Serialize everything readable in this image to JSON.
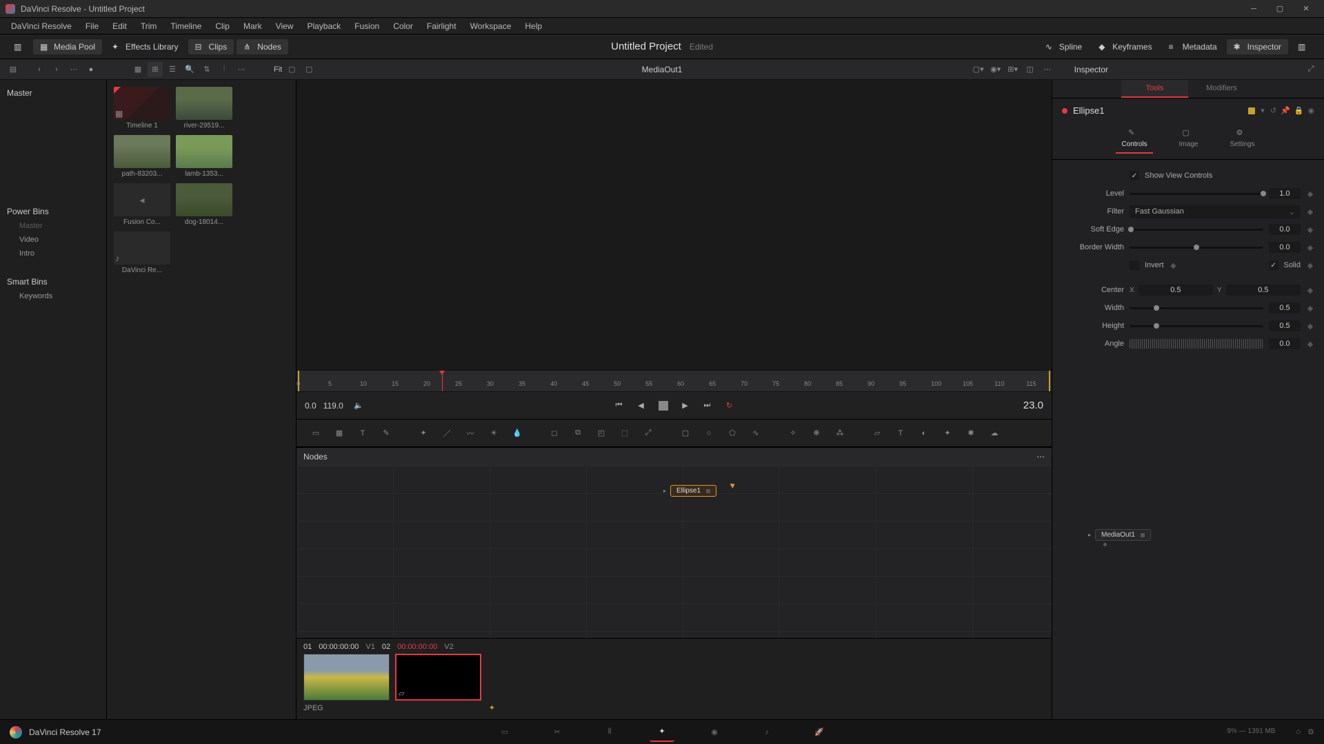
{
  "window": {
    "title": "DaVinci Resolve - Untitled Project"
  },
  "menu": [
    "DaVinci Resolve",
    "File",
    "Edit",
    "Trim",
    "Timeline",
    "Clip",
    "Mark",
    "View",
    "Playback",
    "Fusion",
    "Color",
    "Fairlight",
    "Workspace",
    "Help"
  ],
  "top_toolbar": {
    "media_pool": "Media Pool",
    "effects": "Effects Library",
    "clips": "Clips",
    "nodes": "Nodes",
    "spline": "Spline",
    "keyframes": "Keyframes",
    "metadata": "Metadata",
    "inspector": "Inspector"
  },
  "project": {
    "title": "Untitled Project",
    "status": "Edited"
  },
  "sec_bar": {
    "viewer_label": "MediaOut1",
    "fit": "Fit"
  },
  "sidebar": {
    "master": "Master",
    "power_bins": "Power Bins",
    "bins": [
      "Master",
      "Video",
      "Intro"
    ],
    "smart_bins": "Smart Bins",
    "keywords": "Keywords"
  },
  "media": [
    {
      "name": "Timeline 1",
      "cls": "thumb-timeline",
      "badge": "▦"
    },
    {
      "name": "river-29519...",
      "cls": "thumb-river"
    },
    {
      "name": "path-83203...",
      "cls": "thumb-path"
    },
    {
      "name": "lamb-1353...",
      "cls": "thumb-lamb"
    },
    {
      "name": "Fusion Co...",
      "cls": "thumb-fusion"
    },
    {
      "name": "dog-18014...",
      "cls": "thumb-dog"
    },
    {
      "name": "DaVinci Re...",
      "cls": "thumb-audio",
      "badge": "♪"
    }
  ],
  "ruler_ticks": [
    0,
    5,
    10,
    15,
    20,
    25,
    30,
    35,
    40,
    45,
    50,
    55,
    60,
    65,
    70,
    75,
    80,
    85,
    90,
    95,
    100,
    105,
    110,
    115
  ],
  "transport": {
    "start": "0.0",
    "end": "119.0",
    "current": "23.0"
  },
  "nodes_panel": {
    "title": "Nodes",
    "ellipse": "Ellipse1",
    "mediaout": "MediaOut1"
  },
  "clips": {
    "idx1": "01",
    "tc1": "00:00:00:00",
    "v1": "V1",
    "idx2": "02",
    "tc2": "00:00:00:00",
    "v2": "V2",
    "format": "JPEG"
  },
  "inspector": {
    "title": "Inspector",
    "tabs": {
      "tools": "Tools",
      "modifiers": "Modifiers"
    },
    "node_name": "Ellipse1",
    "subtabs": {
      "controls": "Controls",
      "image": "Image",
      "settings": "Settings"
    },
    "show_view": "Show View Controls",
    "level": {
      "label": "Level",
      "value": "1.0"
    },
    "filter": {
      "label": "Filter",
      "value": "Fast Gaussian"
    },
    "soft_edge": {
      "label": "Soft Edge",
      "value": "0.0"
    },
    "border_width": {
      "label": "Border Width",
      "value": "0.0"
    },
    "invert": "Invert",
    "solid": "Solid",
    "center": {
      "label": "Center",
      "x": "0.5",
      "y": "0.5"
    },
    "width": {
      "label": "Width",
      "value": "0.5"
    },
    "height": {
      "label": "Height",
      "value": "0.5"
    },
    "angle": {
      "label": "Angle",
      "value": "0.0"
    }
  },
  "bottom": {
    "app": "DaVinci Resolve 17",
    "status": "9% — 1391 MB"
  }
}
